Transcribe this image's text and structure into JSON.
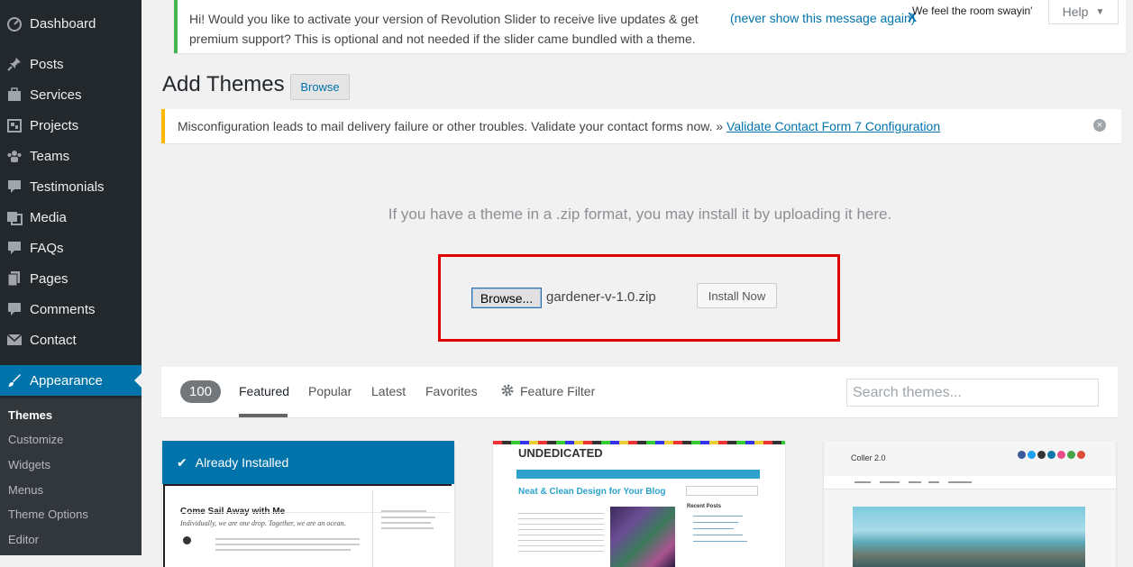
{
  "sidebar": {
    "items": [
      {
        "label": "Dashboard",
        "icon": "dashboard-icon"
      },
      {
        "label": "Posts",
        "icon": "pin-icon"
      },
      {
        "label": "Services",
        "icon": "briefcase-icon"
      },
      {
        "label": "Projects",
        "icon": "portfolio-icon"
      },
      {
        "label": "Teams",
        "icon": "groups-icon"
      },
      {
        "label": "Testimonials",
        "icon": "comment-icon"
      },
      {
        "label": "Media",
        "icon": "media-icon"
      },
      {
        "label": "FAQs",
        "icon": "faq-icon"
      },
      {
        "label": "Pages",
        "icon": "pages-icon"
      },
      {
        "label": "Comments",
        "icon": "comments-icon"
      },
      {
        "label": "Contact",
        "icon": "mail-icon"
      },
      {
        "label": "Appearance",
        "icon": "brush-icon"
      }
    ],
    "submenu": [
      "Themes",
      "Customize",
      "Widgets",
      "Menus",
      "Theme Options",
      "Editor"
    ]
  },
  "notices": {
    "revslider": {
      "text": "Hi! Would you like to activate your version of Revolution Slider to receive live updates & get premium support? This is optional and not needed if the slider came bundled with a theme.",
      "link": "(never show this message again)",
      "close": "X"
    },
    "marquee": "We feel the room swayin'",
    "cf7": {
      "text": "Misconfiguration leads to mail delivery failure or other troubles. Validate your contact forms now. » ",
      "link": "Validate Contact Form 7 Configuration"
    }
  },
  "help_label": "Help",
  "page": {
    "title": "Add Themes",
    "browse_label": "Browse"
  },
  "upload": {
    "hint": "If you have a theme in a .zip format, you may install it by uploading it here.",
    "browse_label": "Browse...",
    "file_name": "gardener-v-1.0.zip",
    "install_label": "Install Now"
  },
  "filter": {
    "count": "100",
    "tabs": [
      "Featured",
      "Popular",
      "Latest",
      "Favorites"
    ],
    "feature_filter": "Feature Filter",
    "search_placeholder": "Search themes..."
  },
  "themes": {
    "installed_label": "Already Installed",
    "card1": {
      "title": "Come Sail Away with Me",
      "subtitle": "Individually, we are one drop. Together, we are an ocean."
    },
    "card2": {
      "title": "UNDEDICATED",
      "heading": "Neat & Clean Design for Your Blog",
      "recent": "Recent Posts"
    },
    "card3": {
      "title": "Coller 2.0"
    }
  },
  "colors": {
    "sidebar_bg": "#23282d",
    "accent": "#0073aa",
    "success": "#46b450",
    "warning": "#ffb900",
    "highlight": "#e00000"
  }
}
